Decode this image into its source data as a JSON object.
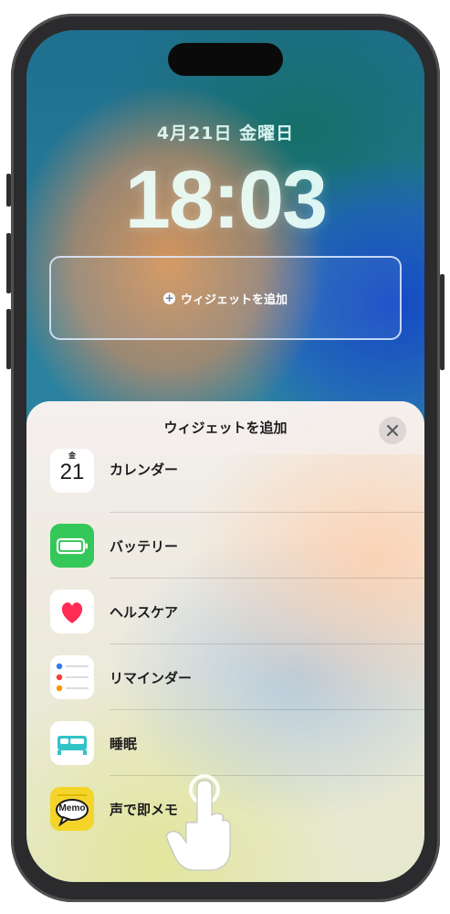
{
  "lock_screen": {
    "date": "4月21日 金曜日",
    "time": "18:03",
    "add_widget_slot_label": "ウィジェットを追加"
  },
  "sheet": {
    "title": "ウィジェットを追加",
    "close_icon": "close-icon",
    "items": [
      {
        "label": "カレンダー",
        "icon": "calendar-icon",
        "icon_day": "金",
        "icon_date": "21"
      },
      {
        "label": "バッテリー",
        "icon": "battery-icon"
      },
      {
        "label": "ヘルスケア",
        "icon": "health-heart-icon"
      },
      {
        "label": "リマインダー",
        "icon": "reminders-icon"
      },
      {
        "label": "睡眠",
        "icon": "sleep-bed-icon"
      },
      {
        "label": "声で即メモ",
        "icon": "memo-app-icon",
        "icon_text": "Memo"
      }
    ]
  },
  "colors": {
    "battery_green": "#34c759",
    "heart_red": "#ff2d55",
    "sleep_teal": "#30c4c9",
    "memo_yellow": "#f5d42a"
  }
}
